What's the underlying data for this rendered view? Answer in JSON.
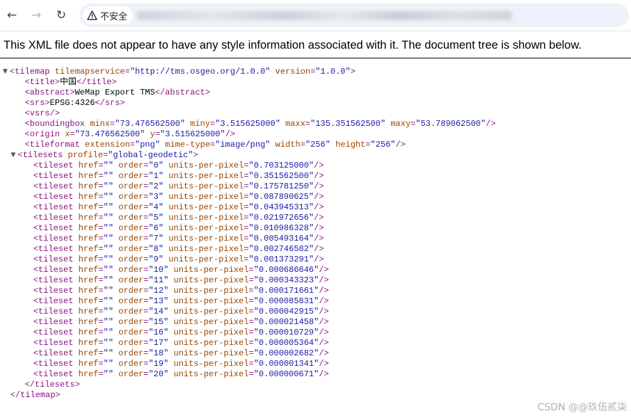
{
  "toolbar": {
    "back_icon": "arrow-left-icon",
    "forward_icon": "arrow-right-icon",
    "reload_icon": "reload-icon",
    "security_label": "不安全",
    "security_icon": "warning-triangle-icon"
  },
  "notice": "This XML file does not appear to have any style information associated with it. The document tree is shown below.",
  "xml": {
    "root": {
      "tag": "tilemap",
      "attrs": [
        {
          "name": "tilemapservice",
          "value": "http://tms.osgeo.org/1.0.0"
        },
        {
          "name": "version",
          "value": "1.0.0"
        }
      ]
    },
    "title": {
      "tag": "title",
      "text": "中国"
    },
    "abstract": {
      "tag": "abstract",
      "text": "WeMap Export TMS"
    },
    "srs": {
      "tag": "srs",
      "text": "EPSG:4326"
    },
    "vsrs": {
      "tag": "vsrs"
    },
    "boundingbox": {
      "tag": "boundingbox",
      "attrs": [
        {
          "name": "minx",
          "value": "73.476562500"
        },
        {
          "name": "miny",
          "value": "3.515625000"
        },
        {
          "name": "maxx",
          "value": "135.351562500"
        },
        {
          "name": "maxy",
          "value": "53.789062500"
        }
      ]
    },
    "origin": {
      "tag": "origin",
      "attrs": [
        {
          "name": "x",
          "value": "73.476562500"
        },
        {
          "name": "y",
          "value": "3.515625000"
        }
      ]
    },
    "tileformat": {
      "tag": "tileformat",
      "attrs": [
        {
          "name": "extension",
          "value": "png"
        },
        {
          "name": "mime-type",
          "value": "image/png"
        },
        {
          "name": "width",
          "value": "256"
        },
        {
          "name": "height",
          "value": "256"
        }
      ]
    },
    "tilesets": {
      "tag": "tilesets",
      "attrs": [
        {
          "name": "profile",
          "value": "global-geodetic"
        }
      ],
      "items": [
        {
          "href": "",
          "order": "0",
          "upp": "0.703125000"
        },
        {
          "href": "",
          "order": "1",
          "upp": "0.351562500"
        },
        {
          "href": "",
          "order": "2",
          "upp": "0.175781250"
        },
        {
          "href": "",
          "order": "3",
          "upp": "0.087890625"
        },
        {
          "href": "",
          "order": "4",
          "upp": "0.043945313"
        },
        {
          "href": "",
          "order": "5",
          "upp": "0.021972656"
        },
        {
          "href": "",
          "order": "6",
          "upp": "0.010986328"
        },
        {
          "href": "",
          "order": "7",
          "upp": "0.005493164"
        },
        {
          "href": "",
          "order": "8",
          "upp": "0.002746582"
        },
        {
          "href": "",
          "order": "9",
          "upp": "0.001373291"
        },
        {
          "href": "",
          "order": "10",
          "upp": "0.000686646"
        },
        {
          "href": "",
          "order": "11",
          "upp": "0.000343323"
        },
        {
          "href": "",
          "order": "12",
          "upp": "0.000171661"
        },
        {
          "href": "",
          "order": "13",
          "upp": "0.000085831"
        },
        {
          "href": "",
          "order": "14",
          "upp": "0.000042915"
        },
        {
          "href": "",
          "order": "15",
          "upp": "0.000021458"
        },
        {
          "href": "",
          "order": "16",
          "upp": "0.000010729"
        },
        {
          "href": "",
          "order": "17",
          "upp": "0.000005364"
        },
        {
          "href": "",
          "order": "18",
          "upp": "0.000002682"
        },
        {
          "href": "",
          "order": "19",
          "upp": "0.000001341"
        },
        {
          "href": "",
          "order": "20",
          "upp": "0.000000671"
        }
      ]
    }
  },
  "watermark": "CSDN @@玖伍贰柒",
  "colors": {
    "tag": "#881280",
    "attr_name": "#994500",
    "attr_value": "#1a1aa6",
    "omnibox_bg": "#edf2fa"
  }
}
